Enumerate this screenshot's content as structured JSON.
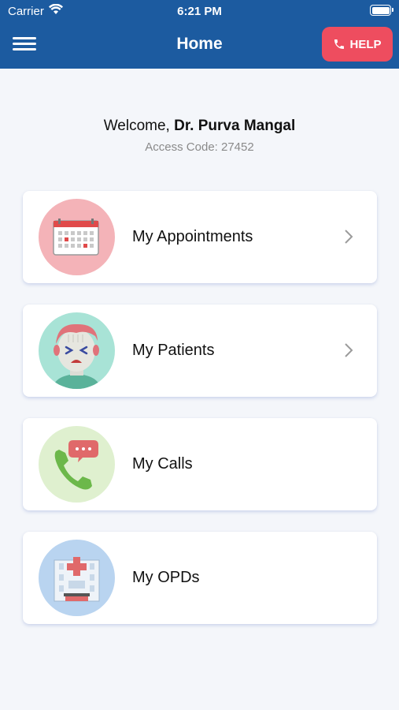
{
  "status_bar": {
    "carrier": "Carrier",
    "time": "6:21 PM"
  },
  "nav": {
    "title": "Home",
    "help_label": "HELP",
    "menu_icon": "hamburger-menu-icon",
    "help_icon": "phone-icon"
  },
  "welcome": {
    "prefix": "Welcome, ",
    "name": "Dr. Purva Mangal",
    "access_code": "Access Code: 27452"
  },
  "menu_items": [
    {
      "label": "My Appointments",
      "icon": "calendar-icon",
      "has_chevron": true,
      "circle_color": "#f4b3b8"
    },
    {
      "label": "My Patients",
      "icon": "sick-patient-icon",
      "has_chevron": true,
      "circle_color": "#a8e3d6"
    },
    {
      "label": "My Calls",
      "icon": "phone-call-chat-icon",
      "has_chevron": false,
      "circle_color": "#dff0cf"
    },
    {
      "label": "My OPDs",
      "icon": "hospital-building-icon",
      "has_chevron": false,
      "circle_color": "#b9d4f0"
    }
  ],
  "colors": {
    "header": "#1c5ba0",
    "help_button": "#ee4d5f",
    "background": "#f4f6fa"
  }
}
